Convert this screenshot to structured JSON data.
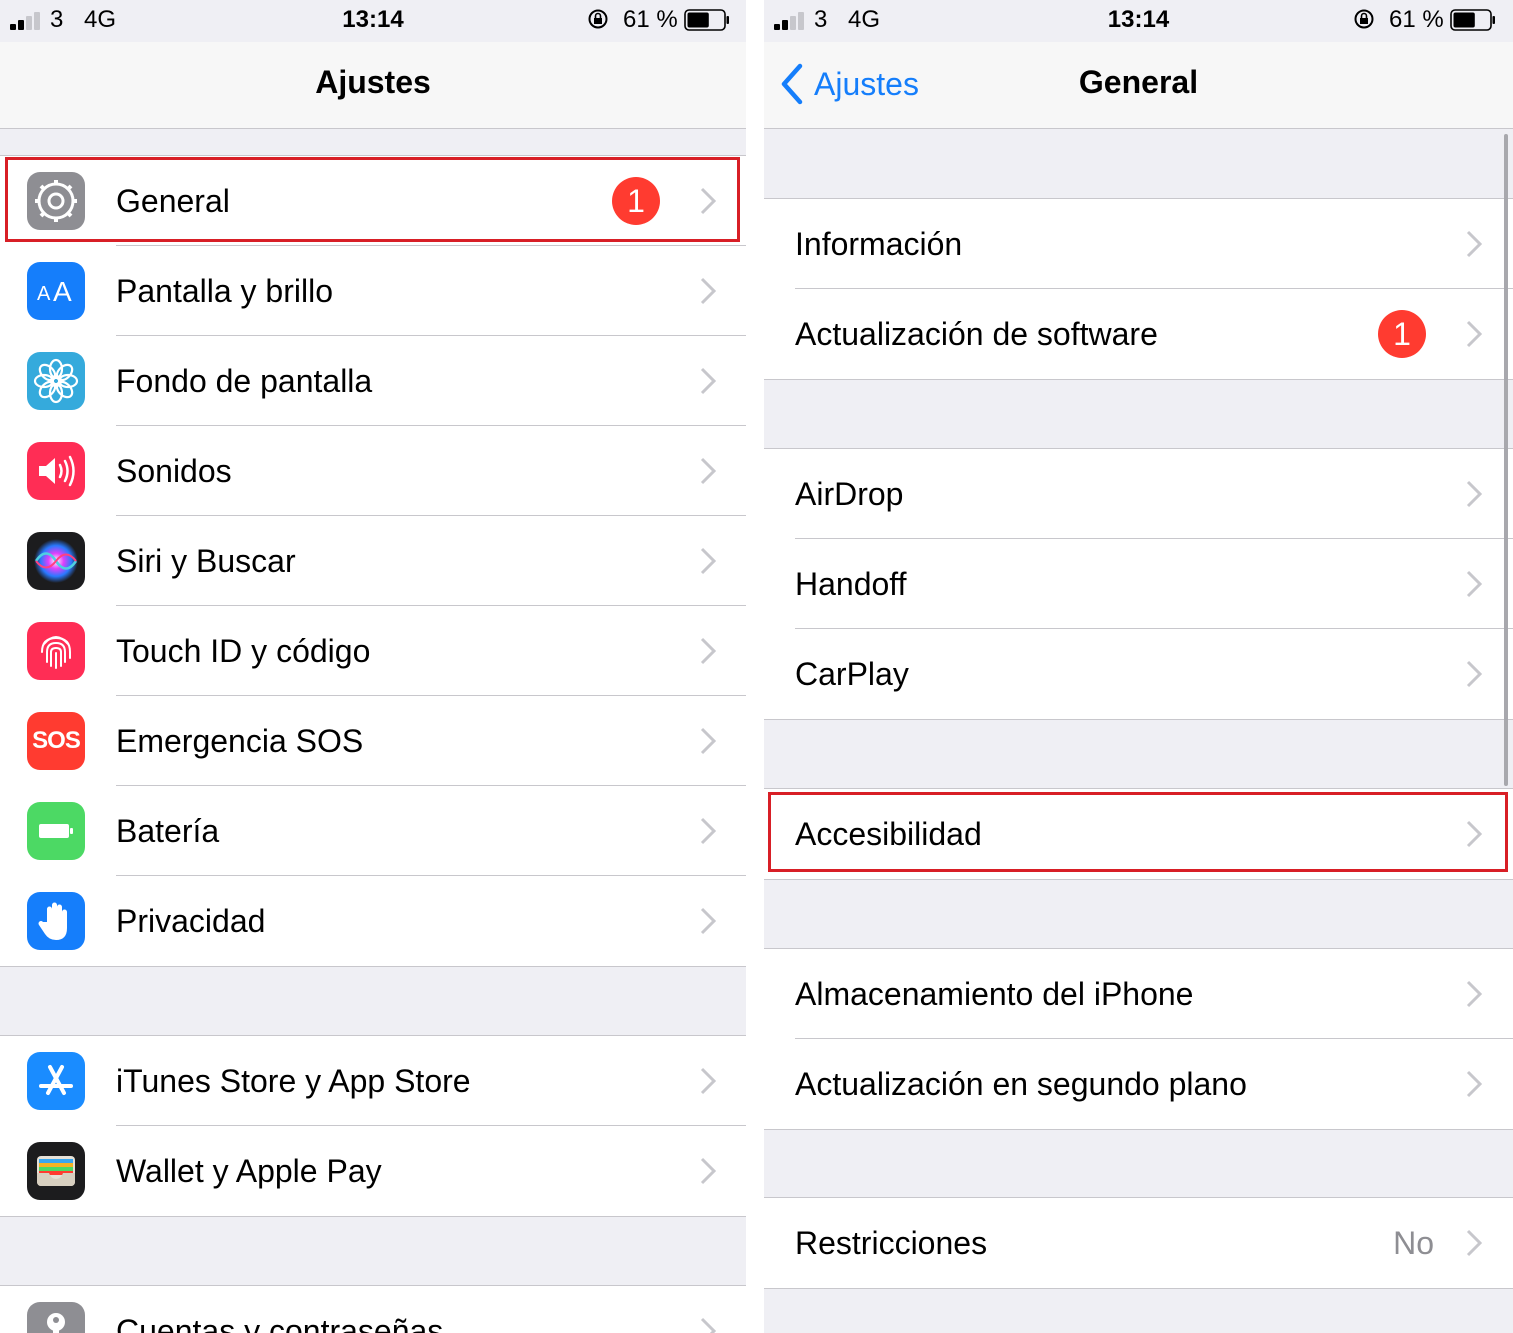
{
  "status_bar": {
    "signal_bars_on": 2,
    "carrier": "3",
    "network": "4G",
    "time": "13:14",
    "orientation_lock_icon": "orientation-lock-icon",
    "battery_percent": "61 %",
    "battery_level": 0.61
  },
  "left_screen": {
    "title": "Ajustes",
    "groups": [
      {
        "rows": [
          {
            "label": "General",
            "icon": "gear-icon",
            "badge": "1",
            "highlighted": true
          },
          {
            "label": "Pantalla y brillo",
            "icon": "display-brightness-icon"
          },
          {
            "label": "Fondo de pantalla",
            "icon": "wallpaper-flower-icon"
          },
          {
            "label": "Sonidos",
            "icon": "speaker-icon"
          },
          {
            "label": "Siri y Buscar",
            "icon": "siri-icon"
          },
          {
            "label": "Touch ID y código",
            "icon": "fingerprint-icon"
          },
          {
            "label": "Emergencia SOS",
            "icon": "sos-icon",
            "icon_text": "SOS"
          },
          {
            "label": "Batería",
            "icon": "battery-icon"
          },
          {
            "label": "Privacidad",
            "icon": "hand-privacy-icon"
          }
        ]
      },
      {
        "rows": [
          {
            "label": "iTunes Store y App Store",
            "icon": "app-store-icon"
          },
          {
            "label": "Wallet y Apple Pay",
            "icon": "wallet-icon"
          }
        ]
      },
      {
        "rows": [
          {
            "label": "Cuentas y contraseñas",
            "icon": "key-icon"
          }
        ]
      }
    ]
  },
  "right_screen": {
    "back_label": "Ajustes",
    "title": "General",
    "groups": [
      {
        "rows": [
          {
            "label": "Información"
          },
          {
            "label": "Actualización de software",
            "badge": "1"
          }
        ]
      },
      {
        "rows": [
          {
            "label": "AirDrop"
          },
          {
            "label": "Handoff"
          },
          {
            "label": "CarPlay"
          }
        ]
      },
      {
        "rows": [
          {
            "label": "Accesibilidad",
            "highlighted": true
          }
        ]
      },
      {
        "rows": [
          {
            "label": "Almacenamiento del iPhone"
          },
          {
            "label": "Actualización en segundo plano"
          }
        ]
      },
      {
        "rows": [
          {
            "label": "Restricciones",
            "value": "No"
          }
        ]
      }
    ]
  },
  "colors": {
    "ios_blue": "#157efb",
    "badge_red": "#ff3b30",
    "highlight_red": "#d81f26",
    "grouped_background": "#efeff4",
    "separator": "#c8c7cc"
  }
}
